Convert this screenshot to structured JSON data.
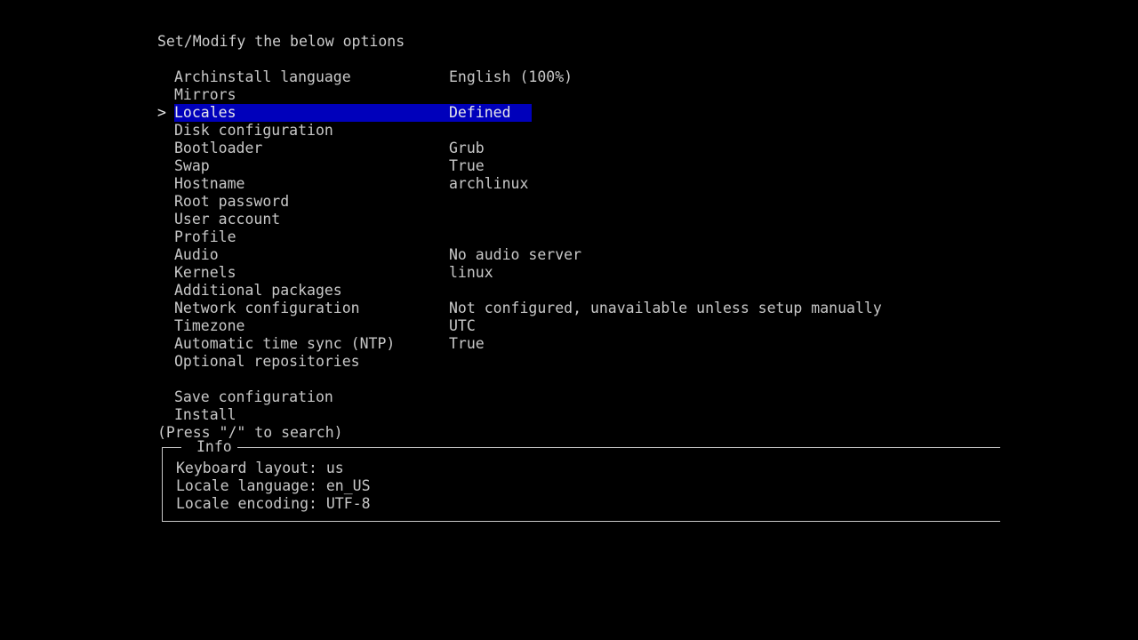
{
  "screen": {
    "title": "Set/Modify the below options",
    "background_color": "#000000",
    "text_color": "#c8c8c8",
    "highlight_color": "#0000bb",
    "highlight_text_color": "#e6e6ea"
  },
  "menu": {
    "cursor_glyph": ">",
    "selected_index": 2,
    "items": [
      {
        "label": "Archinstall language",
        "value": "English (100%)"
      },
      {
        "label": "Mirrors",
        "value": ""
      },
      {
        "label": "Locales",
        "value": "Defined"
      },
      {
        "label": "Disk configuration",
        "value": ""
      },
      {
        "label": "Bootloader",
        "value": "Grub"
      },
      {
        "label": "Swap",
        "value": "True"
      },
      {
        "label": "Hostname",
        "value": "archlinux"
      },
      {
        "label": "Root password",
        "value": ""
      },
      {
        "label": "User account",
        "value": ""
      },
      {
        "label": "Profile",
        "value": ""
      },
      {
        "label": "Audio",
        "value": "No audio server"
      },
      {
        "label": "Kernels",
        "value": "linux"
      },
      {
        "label": "Additional packages",
        "value": ""
      },
      {
        "label": "Network configuration",
        "value": "Not configured, unavailable unless setup manually"
      },
      {
        "label": "Timezone",
        "value": "UTC"
      },
      {
        "label": "Automatic time sync (NTP)",
        "value": "True"
      },
      {
        "label": "Optional repositories",
        "value": ""
      }
    ],
    "actions": [
      {
        "label": "Save configuration",
        "value": ""
      },
      {
        "label": "Install",
        "value": ""
      }
    ]
  },
  "search_hint": "(Press \"/\" to search)",
  "info_panel": {
    "title": "Info",
    "lines": [
      "Keyboard layout: us",
      "Locale language: en_US",
      "Locale encoding: UTF-8"
    ]
  }
}
